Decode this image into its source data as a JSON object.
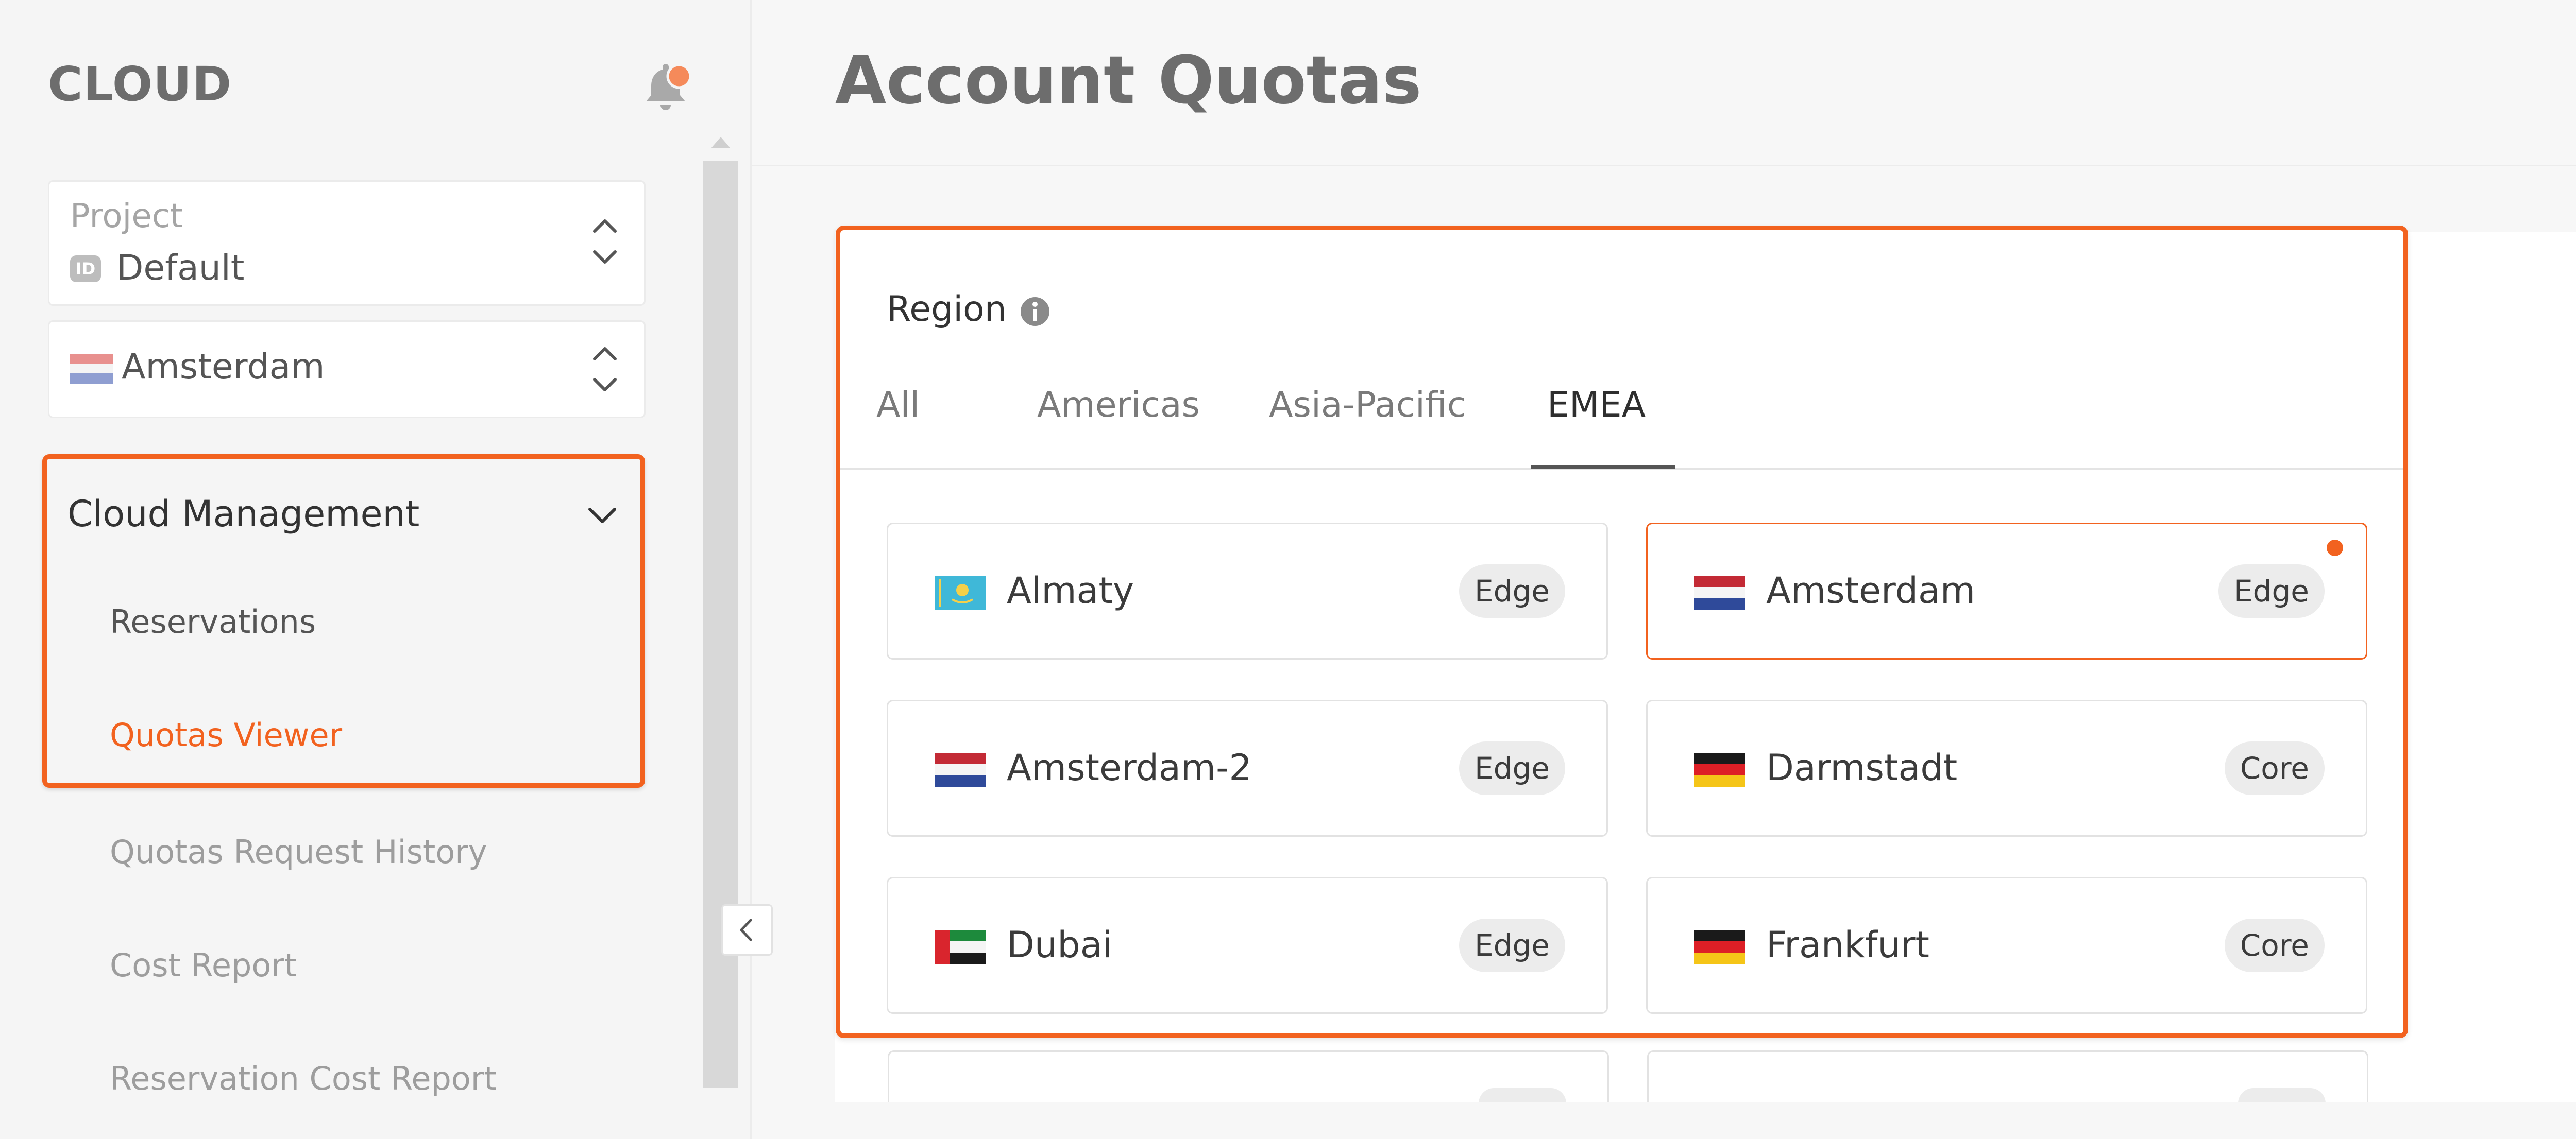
{
  "sidebar": {
    "brand": "CLOUD",
    "project": {
      "caption": "Project",
      "badge": "ID",
      "value": "Default"
    },
    "region": {
      "value": "Amsterdam"
    },
    "group": {
      "title": "Cloud Management",
      "items": [
        {
          "label": "Reservations"
        },
        {
          "label": "Quotas Viewer"
        }
      ]
    },
    "more_items": [
      {
        "label": "Quotas Request History"
      },
      {
        "label": "Cost Report"
      },
      {
        "label": "Reservation Cost Report"
      }
    ]
  },
  "main": {
    "title": "Account Quotas",
    "region_label": "Region",
    "tabs": [
      {
        "label": "All"
      },
      {
        "label": "Americas"
      },
      {
        "label": "Asia-Pacific"
      },
      {
        "label": "EMEA"
      }
    ],
    "locations": [
      {
        "name": "Almaty",
        "badge": "Edge",
        "flag": "kazakhstan-flag"
      },
      {
        "name": "Amsterdam",
        "badge": "Edge",
        "flag": "netherlands-flag"
      },
      {
        "name": "Amsterdam-2",
        "badge": "Edge",
        "flag": "netherlands-flag"
      },
      {
        "name": "Darmstadt",
        "badge": "Core",
        "flag": "germany-flag"
      },
      {
        "name": "Dubai",
        "badge": "Edge",
        "flag": "uae-flag"
      },
      {
        "name": "Frankfurt",
        "badge": "Core",
        "flag": "germany-flag"
      }
    ]
  },
  "colors": {
    "accent": "#f2621f",
    "notification": "#f58a5a"
  },
  "icons": [
    "bell-icon",
    "id-icon",
    "chevron-up-down-icon",
    "chevron-down-icon",
    "chevron-left-icon",
    "info-icon"
  ]
}
